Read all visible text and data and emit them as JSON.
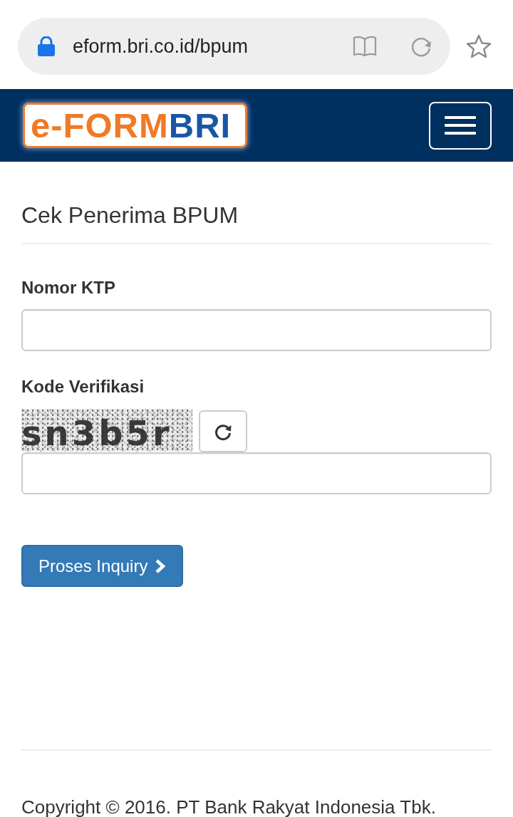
{
  "browser": {
    "url": "eform.bri.co.id/bpum",
    "secure": true
  },
  "navbar": {
    "logo": [
      "e-FORM",
      "BRI"
    ]
  },
  "page": {
    "title": "Cek Penerima BPUM",
    "fields": [
      {
        "kind": "text",
        "label": "Nomor KTP"
      },
      {
        "kind": "captcha",
        "label": "Kode Verifikasi",
        "captcha_text": "sn3b5r"
      }
    ],
    "submit": {
      "label": "Proses Inquiry"
    }
  },
  "footer": {
    "text": "Copyright © 2016. PT Bank Rakyat Indonesia Tbk."
  }
}
